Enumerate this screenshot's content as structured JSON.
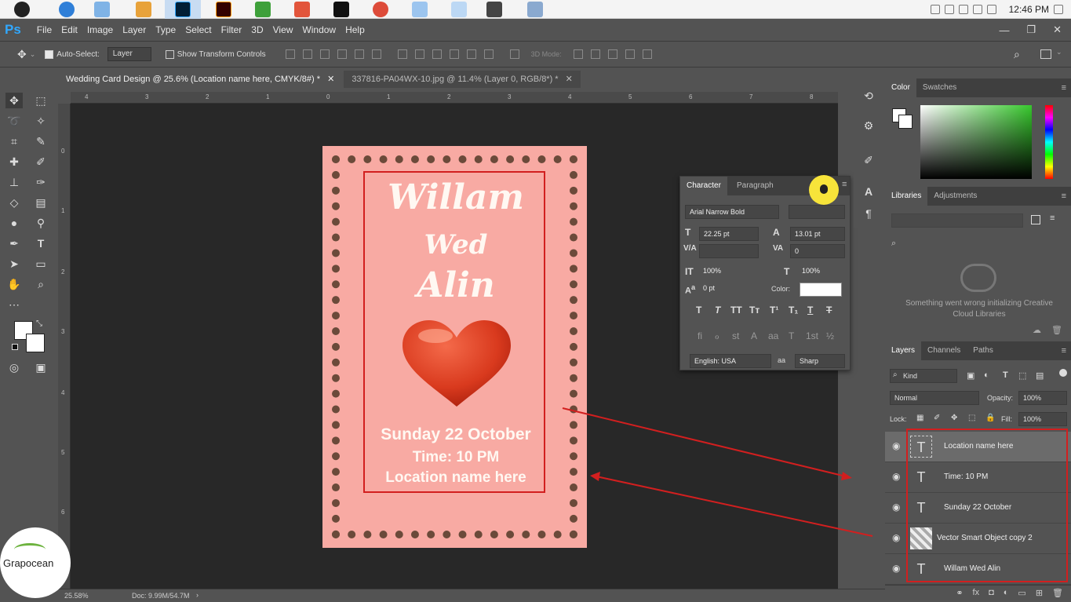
{
  "taskbar": {
    "clock": "12:46 PM"
  },
  "menubar": {
    "logo": "Ps",
    "items": [
      "File",
      "Edit",
      "Image",
      "Layer",
      "Type",
      "Select",
      "Filter",
      "3D",
      "View",
      "Window",
      "Help"
    ]
  },
  "options": {
    "auto_select_label": "Auto-Select:",
    "auto_select_value": "Layer",
    "transform_label": "Show Transform Controls",
    "mode_3d": "3D Mode:"
  },
  "tabs": [
    {
      "label": "Wedding Card Design @ 25.6% (Location name here, CMYK/8#) *"
    },
    {
      "label": "337816-PA04WX-10.jpg @ 11.4% (Layer 0, RGB/8*) *"
    }
  ],
  "ruler": {
    "top": [
      "4",
      "3",
      "2",
      "1",
      "0",
      "1",
      "2",
      "3",
      "4",
      "5",
      "6",
      "7",
      "8"
    ],
    "left": [
      "0",
      "1",
      "2",
      "3",
      "4",
      "5",
      "6"
    ]
  },
  "card": {
    "line1": "Willam",
    "line2": "Wed",
    "line3": "Alin",
    "date": "Sunday 22 October",
    "time": "Time: 10 PM",
    "location": "Location name here"
  },
  "character": {
    "tabs": [
      "Character",
      "Paragraph"
    ],
    "font": "Arial Narrow Bold",
    "size": "22.25 pt",
    "leading": "13.01 pt",
    "tracking": "0",
    "vscale": "100%",
    "hscale": "100%",
    "baseline": "0 pt",
    "color_label": "Color:",
    "language": "English: USA",
    "antialias": "Sharp",
    "aa_label": "aa"
  },
  "color_panel": {
    "tabs": [
      "Color",
      "Swatches"
    ]
  },
  "libraries": {
    "tabs": [
      "Libraries",
      "Adjustments"
    ],
    "error": "Something went wrong initializing Creative Cloud Libraries"
  },
  "layers_panel": {
    "tabs": [
      "Layers",
      "Channels",
      "Paths"
    ],
    "kind": "Kind",
    "blend": "Normal",
    "opacity_label": "Opacity:",
    "opacity": "100%",
    "lock_label": "Lock:",
    "fill_label": "Fill:",
    "fill": "100%",
    "layers": [
      {
        "name": "Location name here",
        "type": "T",
        "selected": true
      },
      {
        "name": "Time: 10 PM",
        "type": "T",
        "selected": false
      },
      {
        "name": "Sunday 22 October",
        "type": "T",
        "selected": false
      },
      {
        "name": "Vector Smart Object copy 2",
        "type": "SO",
        "selected": false
      },
      {
        "name": "Willam  Wed Alin",
        "type": "T",
        "selected": false
      }
    ]
  },
  "status": {
    "zoom": "25.58%",
    "doc": "Doc: 9.99M/54.7M"
  },
  "watermark": {
    "name": "Grapocean"
  },
  "colors": {
    "annotation_red": "#d21f1f",
    "card_pink": "#f8aaa3",
    "ps_blue": "#31a8ff"
  }
}
